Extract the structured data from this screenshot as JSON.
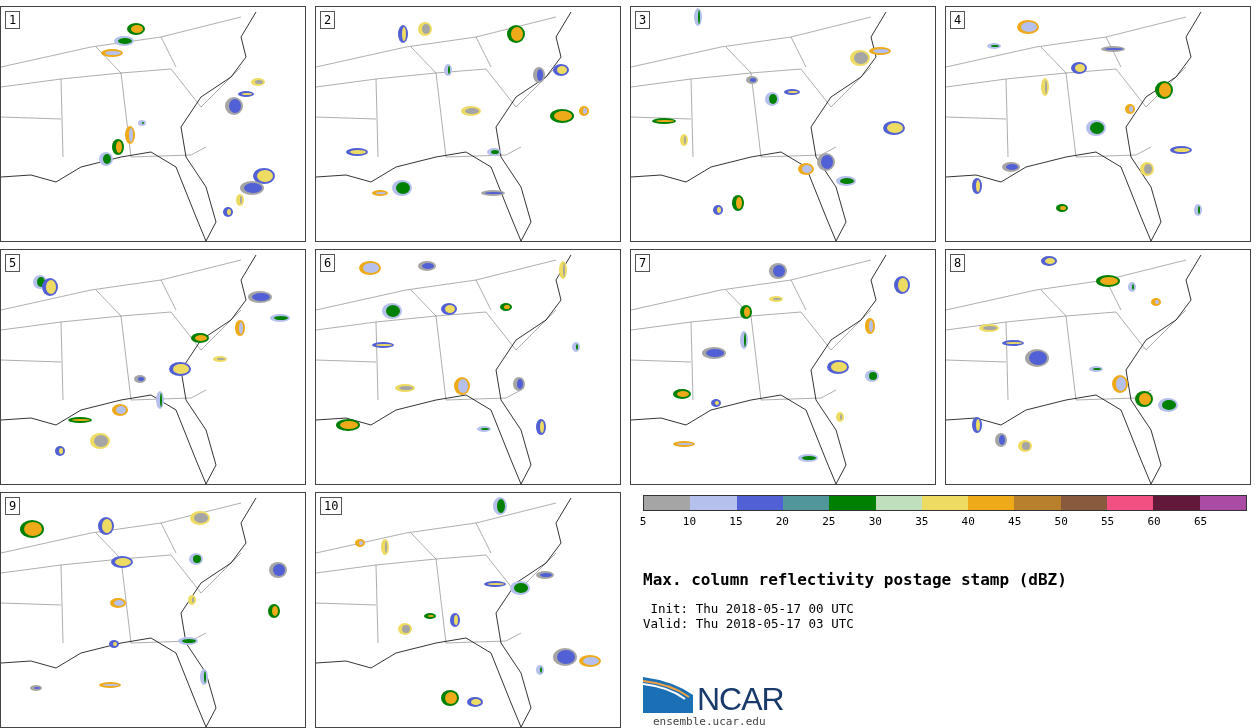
{
  "panels": [
    {
      "label": "1"
    },
    {
      "label": "2"
    },
    {
      "label": "3"
    },
    {
      "label": "4"
    },
    {
      "label": "5"
    },
    {
      "label": "6"
    },
    {
      "label": "7"
    },
    {
      "label": "8"
    },
    {
      "label": "9"
    },
    {
      "label": "10"
    }
  ],
  "colorbar": {
    "segments": [
      {
        "color": "#a5a5a5"
      },
      {
        "color": "#b6c0ec"
      },
      {
        "color": "#5260d6"
      },
      {
        "color": "#50969a"
      },
      {
        "color": "#008000"
      },
      {
        "color": "#bfdfbd"
      },
      {
        "color": "#eedc62"
      },
      {
        "color": "#eeaa18"
      },
      {
        "color": "#b8802c"
      },
      {
        "color": "#8a5a3e"
      },
      {
        "color": "#f25082"
      },
      {
        "color": "#621838"
      },
      {
        "color": "#aa4ca4"
      }
    ],
    "ticks": [
      "5",
      "10",
      "15",
      "20",
      "25",
      "30",
      "35",
      "40",
      "45",
      "50",
      "55",
      "60",
      "65"
    ]
  },
  "title": "Max. column reflectivity postage stamp (dBZ)",
  "info_lines": [
    {
      "label": "Init:",
      "value": "Thu 2018-05-17 00 UTC"
    },
    {
      "label": "Valid:",
      "value": "Thu 2018-05-17 03 UTC"
    }
  ],
  "logo": {
    "wordmark": "NCAR",
    "url": "ensemble.ucar.edu"
  }
}
